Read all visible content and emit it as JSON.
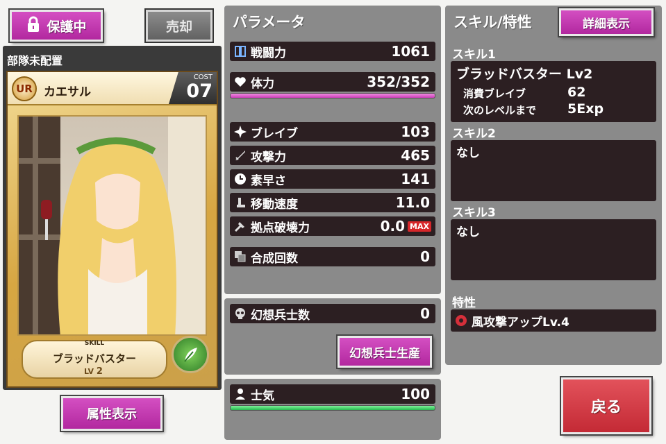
{
  "left": {
    "protect_label": "保護中",
    "sell_label": "売却",
    "deploy_status": "部隊未配置",
    "card": {
      "rarity": "UR",
      "name": "カエサル",
      "cost_label": "COST",
      "cost_value": "07",
      "skill_tag": "SKILL",
      "skill_name": "ブラッドバスター",
      "level_label": "LV",
      "level_value": "2"
    },
    "attribute_label": "属性表示"
  },
  "params": {
    "title": "パラメータ",
    "combat_label": "戦闘力",
    "combat_value": "1061",
    "hp_label": "体力",
    "hp_value": "352/352",
    "hp_fill": 1.0,
    "stats": [
      {
        "label": "ブレイブ",
        "value": "103",
        "icon": "burst-icon"
      },
      {
        "label": "攻撃力",
        "value": "465",
        "icon": "sword-icon"
      },
      {
        "label": "素早さ",
        "value": "141",
        "icon": "clock-icon"
      },
      {
        "label": "移動速度",
        "value": "11.0",
        "icon": "boot-icon"
      },
      {
        "label": "拠点破壊力",
        "value": "0.0",
        "icon": "hammer-icon",
        "badge": "MAX"
      }
    ],
    "synth_label": "合成回数",
    "synth_value": "0"
  },
  "phantom": {
    "label": "幻想兵士数",
    "value": "0",
    "button_label": "幻想兵士生産"
  },
  "morale": {
    "label": "士気",
    "value": "100",
    "fill": 1.0
  },
  "skills": {
    "title": "スキル/特性",
    "detail_label": "詳細表示",
    "skill1_header": "スキル1",
    "skill1_name": "ブラッドバスター Lv2",
    "skill1_cost_label": "消費ブレイブ",
    "skill1_cost_value": "62",
    "skill1_next_label": "次のレベルまで",
    "skill1_next_value": "5Exp",
    "skill2_header": "スキル2",
    "skill2_value": "なし",
    "skill3_header": "スキル3",
    "skill3_value": "なし",
    "trait_header": "特性",
    "trait_value": "風攻撃アップLv.4"
  },
  "back_label": "戻る",
  "colors": {
    "magenta": "#c23aae",
    "hp_bar": "#d75ac8",
    "morale_bar": "#3fcf6a",
    "max_badge": "#d7262a"
  }
}
